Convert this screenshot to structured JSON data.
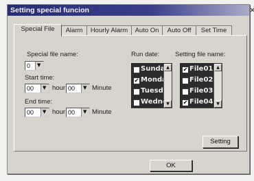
{
  "window": {
    "title": "Setting special funcion",
    "close_glyph": "×"
  },
  "tabs": [
    "Special File",
    "Alarm",
    "Hourly Alarm",
    "Auto On",
    "Auto Off",
    "Set Time"
  ],
  "special_file": {
    "name_label": "Special file name:",
    "name_value": "0",
    "start_label": "Start time:",
    "start_hour": "00",
    "start_minute": "00",
    "end_label": "End time:",
    "end_hour": "00",
    "end_minute": "00",
    "hour_unit": "hour",
    "minute_unit": "Minute"
  },
  "run_date": {
    "label": "Run date:",
    "items": [
      {
        "text": "Sunday",
        "checked": false
      },
      {
        "text": "Monday",
        "checked": true
      },
      {
        "text": "Tuesday",
        "checked": false
      },
      {
        "text": "Wednesday",
        "checked": false
      }
    ]
  },
  "setting_file": {
    "label": "Setting file name:",
    "items": [
      {
        "text": "File01",
        "checked": true
      },
      {
        "text": "File02",
        "checked": false
      },
      {
        "text": "File03",
        "checked": false
      },
      {
        "text": "File04",
        "checked": true
      }
    ]
  },
  "buttons": {
    "setting": "Setting",
    "ok": "OK"
  }
}
